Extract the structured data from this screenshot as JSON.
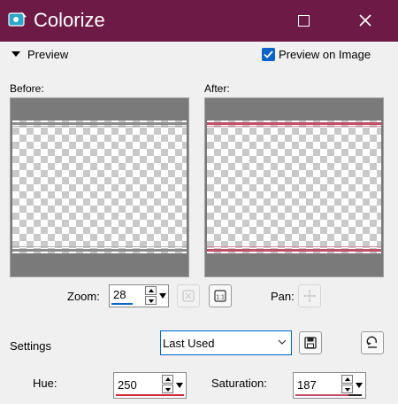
{
  "window": {
    "title": "Colorize"
  },
  "preview_section": {
    "label": "Preview",
    "preview_on_image_label": "Preview on Image",
    "preview_on_image_checked": true
  },
  "before": {
    "label": "Before:"
  },
  "after": {
    "label": "After:"
  },
  "zoom": {
    "label": "Zoom:",
    "value": "28"
  },
  "pan": {
    "label": "Pan:"
  },
  "settings": {
    "label": "Settings",
    "preset_value": "Last Used"
  },
  "hue": {
    "label": "Hue:",
    "value": "250",
    "indicator_color": "#d0243a"
  },
  "saturation": {
    "label": "Saturation:",
    "value": "187"
  },
  "colors": {
    "titlebar": "#6e1a46",
    "accent_blue": "#0a64c8",
    "after_stripe": "#c0506a",
    "before_stripe": "#8c8c8c"
  },
  "icons": {
    "app": "colorize-app-icon",
    "maximize": "maximize-icon",
    "close": "close-icon",
    "collapse": "triangle-down-icon",
    "check": "checkmark-icon",
    "zoom_fit": "zoom-fit-icon",
    "zoom_actual": "actual-size-icon",
    "pan": "move-cross-icon",
    "save": "floppy-disk-icon",
    "reset": "reset-defaults-icon"
  }
}
